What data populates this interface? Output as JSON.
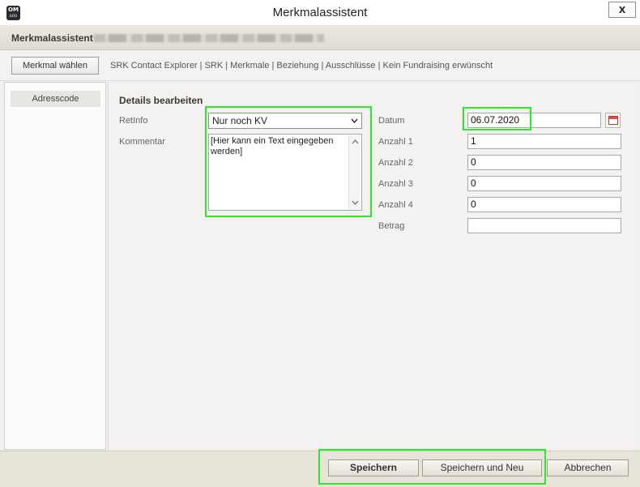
{
  "window": {
    "title": "Merkmalassistent",
    "icon_text": "OM",
    "icon_subtext": "ADD",
    "close_label": "x"
  },
  "header": {
    "title": "Merkmalassistent"
  },
  "nav": {
    "merkmal_button": "Merkmal wählen",
    "breadcrumb": "SRK Contact Explorer | SRK | Merkmale | Beziehung | Ausschlüsse | Kein Fundraising erwünscht"
  },
  "sidebar": {
    "items": [
      {
        "label": "Adresscode"
      }
    ]
  },
  "form": {
    "section_title": "Details bearbeiten",
    "retinfo": {
      "label": "RetInfo",
      "value": "Nur noch KV"
    },
    "kommentar": {
      "label": "Kommentar",
      "value": "[Hier kann ein Text eingegeben werden]"
    },
    "datum": {
      "label": "Datum",
      "value": "06.07.2020"
    },
    "anzahl1": {
      "label": "Anzahl 1",
      "value": "1"
    },
    "anzahl2": {
      "label": "Anzahl 2",
      "value": "0"
    },
    "anzahl3": {
      "label": "Anzahl 3",
      "value": "0"
    },
    "anzahl4": {
      "label": "Anzahl 4",
      "value": "0"
    },
    "betrag": {
      "label": "Betrag",
      "value": ""
    }
  },
  "footer": {
    "save": "Speichern",
    "save_new": "Speichern und Neu",
    "cancel": "Abbrechen"
  },
  "colors": {
    "highlight": "#2ee62e",
    "header_band": "#e4dfd6",
    "footer_band": "#e9e4da"
  },
  "icons": {
    "dropdown": "chevron-down-icon",
    "calendar": "calendar-icon",
    "scroll_up": "chevron-up-icon",
    "scroll_down": "chevron-down-icon"
  }
}
